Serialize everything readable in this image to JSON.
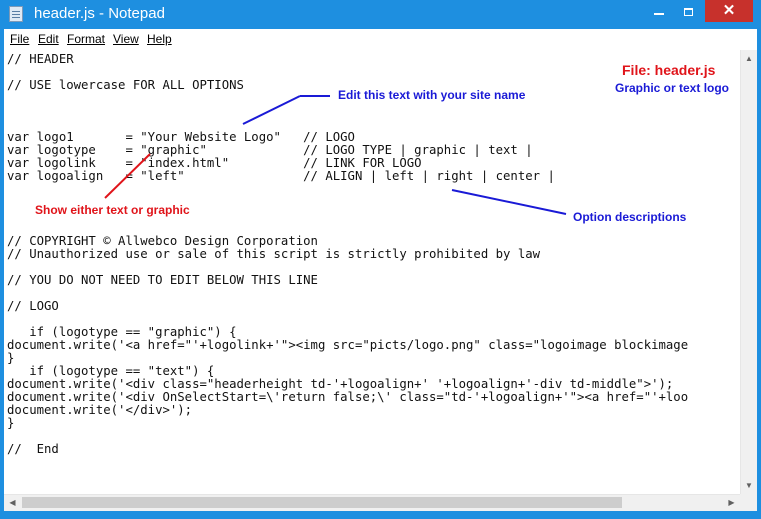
{
  "window": {
    "title": "header.js - Notepad",
    "close_glyph": "✕"
  },
  "menu": [
    "File",
    "Edit",
    "Format",
    "View",
    "Help"
  ],
  "code_lines": [
    "// HEADER",
    "",
    "// USE lowercase FOR ALL OPTIONS",
    "",
    "",
    "",
    "var logo1       = \"Your Website Logo\"   // LOGO",
    "var logotype    = \"graphic\"             // LOGO TYPE | graphic | text |",
    "var logolink    = \"index.html\"          // LINK FOR LOGO",
    "var logoalign   = \"left\"                // ALIGN | left | right | center |",
    "",
    "",
    "",
    "",
    "// COPYRIGHT © Allwebco Design Corporation",
    "// Unauthorized use or sale of this script is strictly prohibited by law",
    "",
    "// YOU DO NOT NEED TO EDIT BELOW THIS LINE",
    "",
    "// LOGO",
    "",
    "   if (logotype == \"graphic\") {",
    "document.write('<a href=\"'+logolink+'\"><img src=\"picts/logo.png\" class=\"logoimage blockimage",
    "}",
    "   if (logotype == \"text\") {",
    "document.write('<div class=\"headerheight td-'+logoalign+' '+logoalign+'-div td-middle\">');",
    "document.write('<div OnSelectStart=\\'return false;\\' class=\"td-'+logoalign+'\"><a href=\"'+loo",
    "document.write('</div>');",
    "}",
    "",
    "//  End"
  ],
  "annotations": {
    "file_label": "File: header.js",
    "graphic_label": "Graphic or text logo",
    "edit_label": "Edit this text with your site name",
    "show_label": "Show either text or graphic",
    "option_label": "Option descriptions"
  },
  "colors": {
    "titlebar": "#1e8fe0",
    "close": "#c7312c",
    "annotation_blue": "#1a1ad6",
    "annotation_red": "#e0141a"
  },
  "icons": {
    "app": "notepad-icon",
    "minimize": "minimize-icon",
    "maximize": "maximize-icon",
    "close": "close-icon"
  }
}
